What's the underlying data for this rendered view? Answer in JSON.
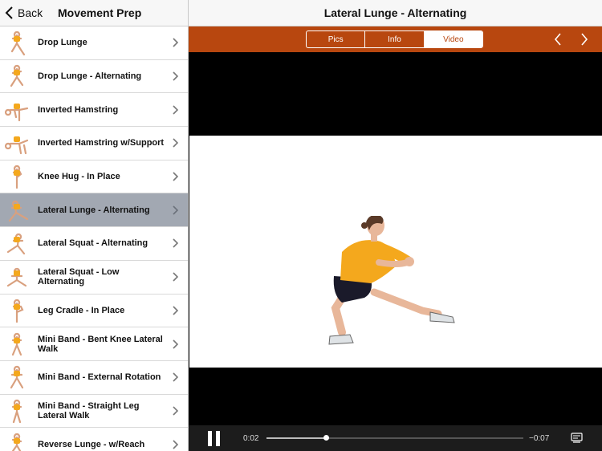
{
  "sidebar": {
    "back_label": "Back",
    "title": "Movement Prep",
    "items": [
      {
        "label": "Drop Lunge",
        "selected": false
      },
      {
        "label": "Drop Lunge - Alternating",
        "selected": false
      },
      {
        "label": "Inverted Hamstring",
        "selected": false
      },
      {
        "label": "Inverted Hamstring w/Support",
        "selected": false
      },
      {
        "label": "Knee Hug - In Place",
        "selected": false
      },
      {
        "label": "Lateral Lunge - Alternating",
        "selected": true
      },
      {
        "label": "Lateral Squat - Alternating",
        "selected": false
      },
      {
        "label": "Lateral Squat - Low Alternating",
        "selected": false
      },
      {
        "label": "Leg Cradle - In Place",
        "selected": false
      },
      {
        "label": "Mini Band - Bent Knee Lateral Walk",
        "selected": false
      },
      {
        "label": "Mini Band - External Rotation",
        "selected": false
      },
      {
        "label": "Mini Band - Straight Leg Lateral Walk",
        "selected": false
      },
      {
        "label": "Reverse Lunge - w/Reach",
        "selected": false
      }
    ]
  },
  "main": {
    "title": "Lateral Lunge - Alternating",
    "tabs": [
      {
        "label": "Pics",
        "active": false
      },
      {
        "label": "Info",
        "active": false
      },
      {
        "label": "Video",
        "active": true
      }
    ]
  },
  "player": {
    "elapsed": "0:02",
    "remaining": "−0:07",
    "progress": 0.23
  },
  "colors": {
    "accent": "#b8470f",
    "selected_row": "#a2a8b2",
    "shirt": "#f4a81d",
    "shorts": "#1a1a2a"
  },
  "icons": {
    "back": "chevron-left-icon",
    "row": "chevron-right-icon",
    "prev": "chevron-left-icon",
    "next": "chevron-right-icon",
    "pause": "pause-icon",
    "captions": "captions-icon"
  }
}
